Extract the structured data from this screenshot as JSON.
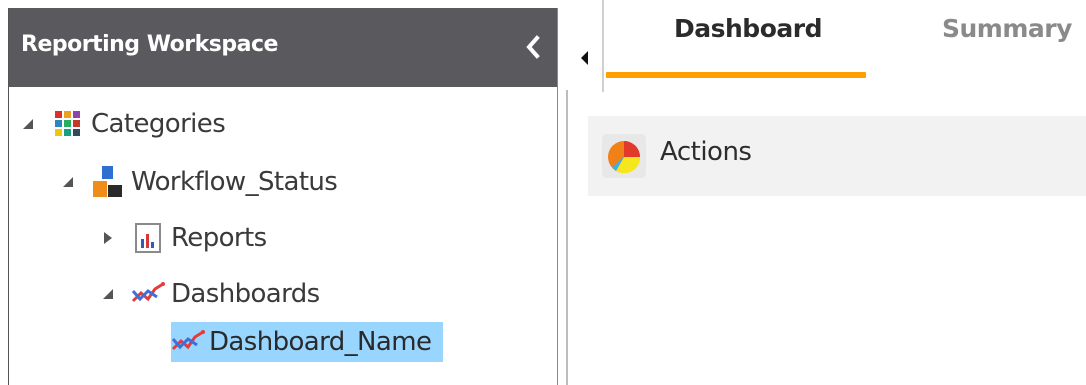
{
  "header": {
    "caption": ""
  },
  "sidebar": {
    "title": "Reporting Workspace",
    "collapse_icon": "chevron-left-icon",
    "tree": [
      {
        "label": "Categories",
        "icon": "categories-grid-icon",
        "toggle": "expanded"
      },
      {
        "label": "Workflow_Status",
        "icon": "workflow-blocks-icon",
        "toggle": "expanded"
      },
      {
        "label": "Reports",
        "icon": "report-chart-icon",
        "toggle": "collapsed"
      },
      {
        "label": "Dashboards",
        "icon": "dashboard-line-icon",
        "toggle": "expanded"
      },
      {
        "label": "Dashboard_Name",
        "icon": "dashboard-line-icon",
        "selected": true
      }
    ]
  },
  "main": {
    "tabs": [
      {
        "label": "Dashboard",
        "active": true
      },
      {
        "label": "Summary",
        "active": false
      }
    ],
    "action": {
      "label": "Actions",
      "icon": "pie-chart-icon"
    }
  },
  "colors": {
    "header_bg": "#5a5a5e",
    "tab_accent": "#ff9f00",
    "selection_bg": "#99d6ff",
    "action_bg": "#f2f2f2"
  }
}
